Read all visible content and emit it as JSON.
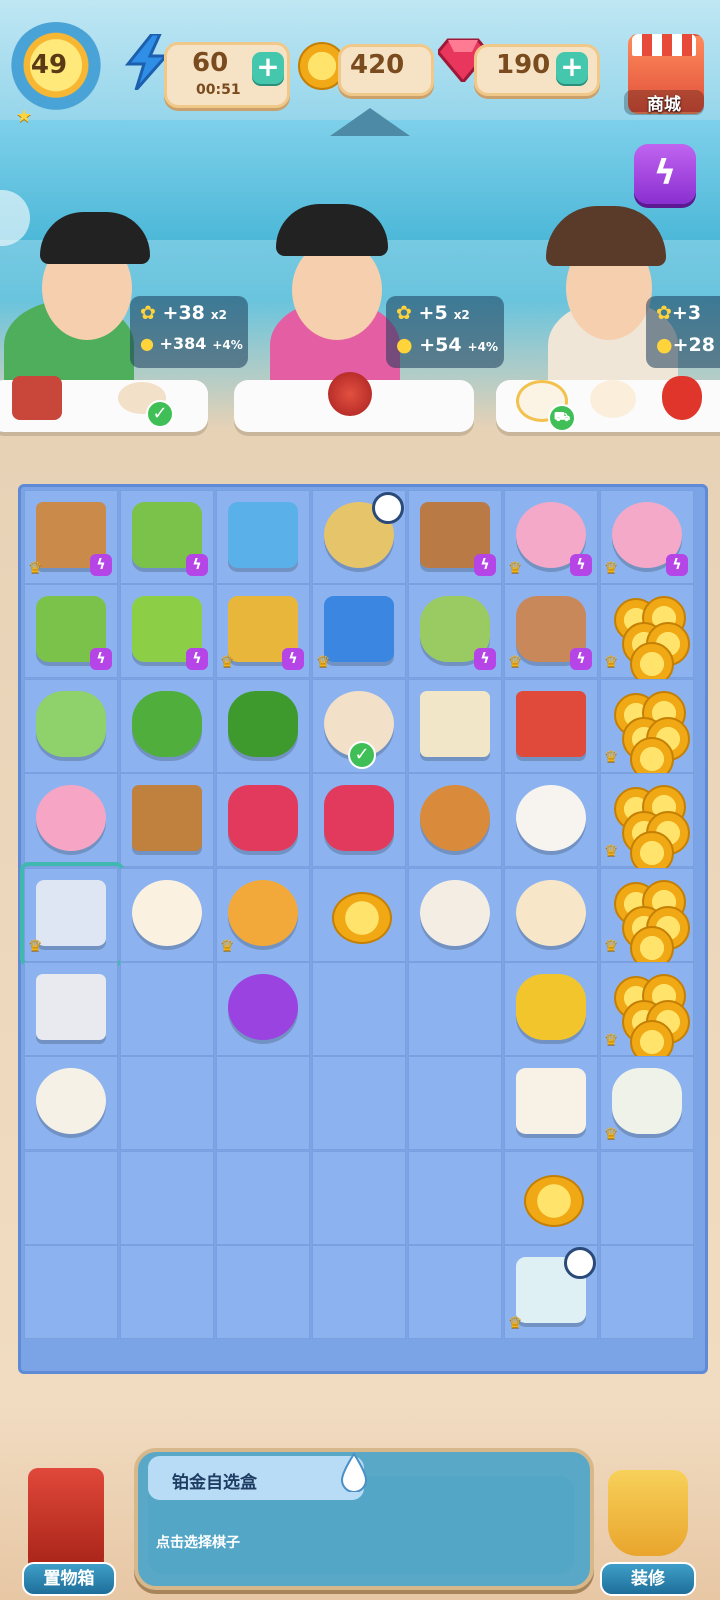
{
  "level": {
    "value": "49"
  },
  "resources": {
    "energy": {
      "value": "60",
      "timer": "00:51",
      "plus": "+"
    },
    "coins": {
      "value": "420"
    },
    "gems": {
      "value": "190",
      "plus": "+"
    }
  },
  "shop": {
    "label": "商城"
  },
  "boost": {
    "icon": "lightning-icon",
    "glyph": "ϟ"
  },
  "customers": [
    {
      "exp": "+38",
      "exp_mult": "x2",
      "coins": "+384",
      "coin_bonus": "+4%"
    },
    {
      "exp": "+5",
      "exp_mult": "x2",
      "coins": "+54",
      "coin_bonus": "+4%"
    },
    {
      "exp": "+3",
      "coins": "+28"
    }
  ],
  "board": {
    "cols": 7,
    "rows": 9,
    "items": [
      [
        "vegetable-basket",
        "coffee-machine",
        "mini-fridge",
        "cooking-pot",
        "cherry-basket",
        "piggy-bank",
        "piggy-bank"
      ],
      [
        "coffee-machine",
        "juicer",
        "fish-tank",
        "treasure-chest",
        "bokchoy-basket",
        "cherry-basket-small",
        "coin-stack"
      ],
      [
        "bok-choy",
        "broccoli",
        "cucumber",
        "fish-plate",
        "paper-scissors",
        "watermelon",
        "coin-stack"
      ],
      [
        "noodle-bowl",
        "wooden-crate",
        "ruby",
        "rubies",
        "fried-fish",
        "lemon-tea",
        "coin-stack"
      ],
      [
        "mystery-box",
        "steamed-bun",
        "energy-bubble",
        "gold-coin",
        "bento-box",
        "sesame-bun",
        "coin-stack"
      ],
      [
        "lunch-tray",
        "",
        "energy-orb",
        "",
        "",
        "corn",
        "coin-stack"
      ],
      [
        "corn-soup",
        "",
        "",
        "",
        "",
        "takeout-box",
        "tea-set"
      ],
      [
        "",
        "",
        "",
        "",
        "",
        "gold-coin",
        ""
      ],
      [
        "",
        "",
        "",
        "",
        "",
        "first-aid-kit",
        ""
      ]
    ]
  },
  "info_panel": {
    "title": "铂金自选盒",
    "description": "点击选择棋子"
  },
  "bottom": {
    "storage_label": "置物箱",
    "decorate_label": "装修"
  }
}
